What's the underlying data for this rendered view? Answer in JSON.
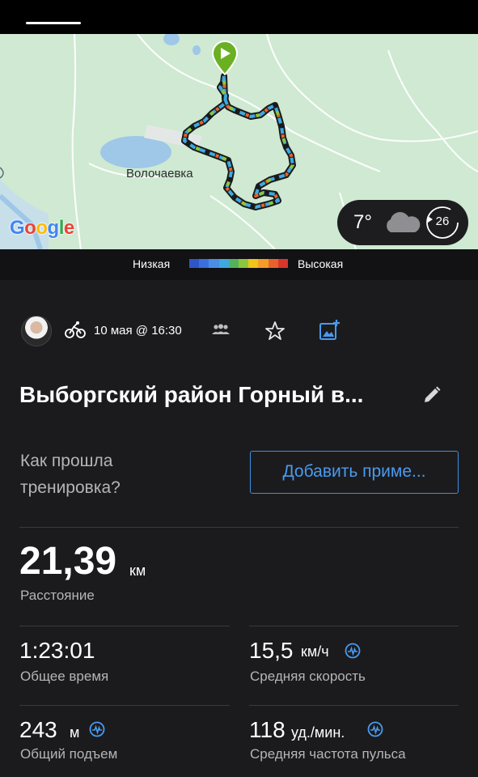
{
  "map": {
    "place_label": "Волочаевка",
    "google_logo": "Google"
  },
  "weather": {
    "temperature": "7°",
    "icon": "cloud-icon",
    "wind_value": "26"
  },
  "legend": {
    "low_label": "Низкая",
    "high_label": "Высокая",
    "colors": [
      "#2f56c9",
      "#3b6fdc",
      "#4a8ee6",
      "#3fa9e0",
      "#53b35a",
      "#8cc63f",
      "#f0c419",
      "#f39c27",
      "#e8632b",
      "#d8362b"
    ]
  },
  "activity": {
    "date": "10 мая @ 16:30",
    "title": "Выборгский район Горный в...",
    "question": "Как прошла тренировка?",
    "add_note_button": "Добавить приме..."
  },
  "stats": {
    "distance": {
      "value": "21,39",
      "unit": "км",
      "label": "Расстояние"
    },
    "total_time": {
      "value": "1:23:01",
      "label": "Общее время"
    },
    "avg_speed": {
      "value": "15,5",
      "unit": "км/ч",
      "label": "Средняя скорость"
    },
    "elevation_gain": {
      "value": "243",
      "unit": "м",
      "label": "Общий подъем"
    },
    "avg_hr": {
      "value": "118",
      "unit": "уд./мин.",
      "label": "Средняя частота пульса"
    }
  },
  "colors": {
    "accent_blue": "#4a9af0",
    "background": "#1b1b1d",
    "start_marker": "#6ab023"
  }
}
